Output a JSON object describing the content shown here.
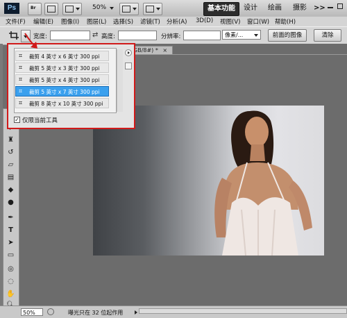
{
  "titlebar": {
    "logo": "Ps",
    "zoom": "50%",
    "workspaces": [
      {
        "label": "基本功能",
        "active": true
      },
      {
        "label": "设计",
        "active": false
      },
      {
        "label": "绘画",
        "active": false
      },
      {
        "label": "摄影",
        "active": false
      }
    ],
    "more": ">>"
  },
  "menu": [
    "文件(F)",
    "编辑(E)",
    "图像(I)",
    "图层(L)",
    "选择(S)",
    "滤镜(T)",
    "分析(A)",
    "3D(D)",
    "视图(V)",
    "窗口(W)",
    "帮助(H)"
  ],
  "options": {
    "width_label": "宽度:",
    "height_label": "高度:",
    "resolution_label": "分辨率:",
    "unit_value": "像素/...",
    "front_image_button": "前面的图像",
    "clear_button": "清除",
    "width_value": "",
    "height_value": "",
    "resolution_value": ""
  },
  "document": {
    "tab_label": "GB/8#) *",
    "close": "×"
  },
  "preset_popup": {
    "items": [
      {
        "label": "裁剪 4 英寸 x 6 英寸 300 ppi",
        "selected": false
      },
      {
        "label": "裁剪 5 英寸 x 3 英寸 300 ppi",
        "selected": false
      },
      {
        "label": "裁剪 5 英寸 x 4 英寸 300 ppi",
        "selected": false
      },
      {
        "label": "裁剪 5 英寸 x 7 英寸 300 ppi",
        "selected": true
      },
      {
        "label": "裁剪 8 英寸 x 10 英寸 300 ppi",
        "selected": false
      }
    ],
    "current_tool_only_label": "仅限当前工具",
    "current_tool_only_checked": true
  },
  "status": {
    "zoom": "50%",
    "message": "曝光只在 32 位起作用"
  },
  "colors": {
    "highlight": "#3aa0ee",
    "annotation_red": "#d11a1a",
    "active_workspace": "#2d2d2d"
  }
}
